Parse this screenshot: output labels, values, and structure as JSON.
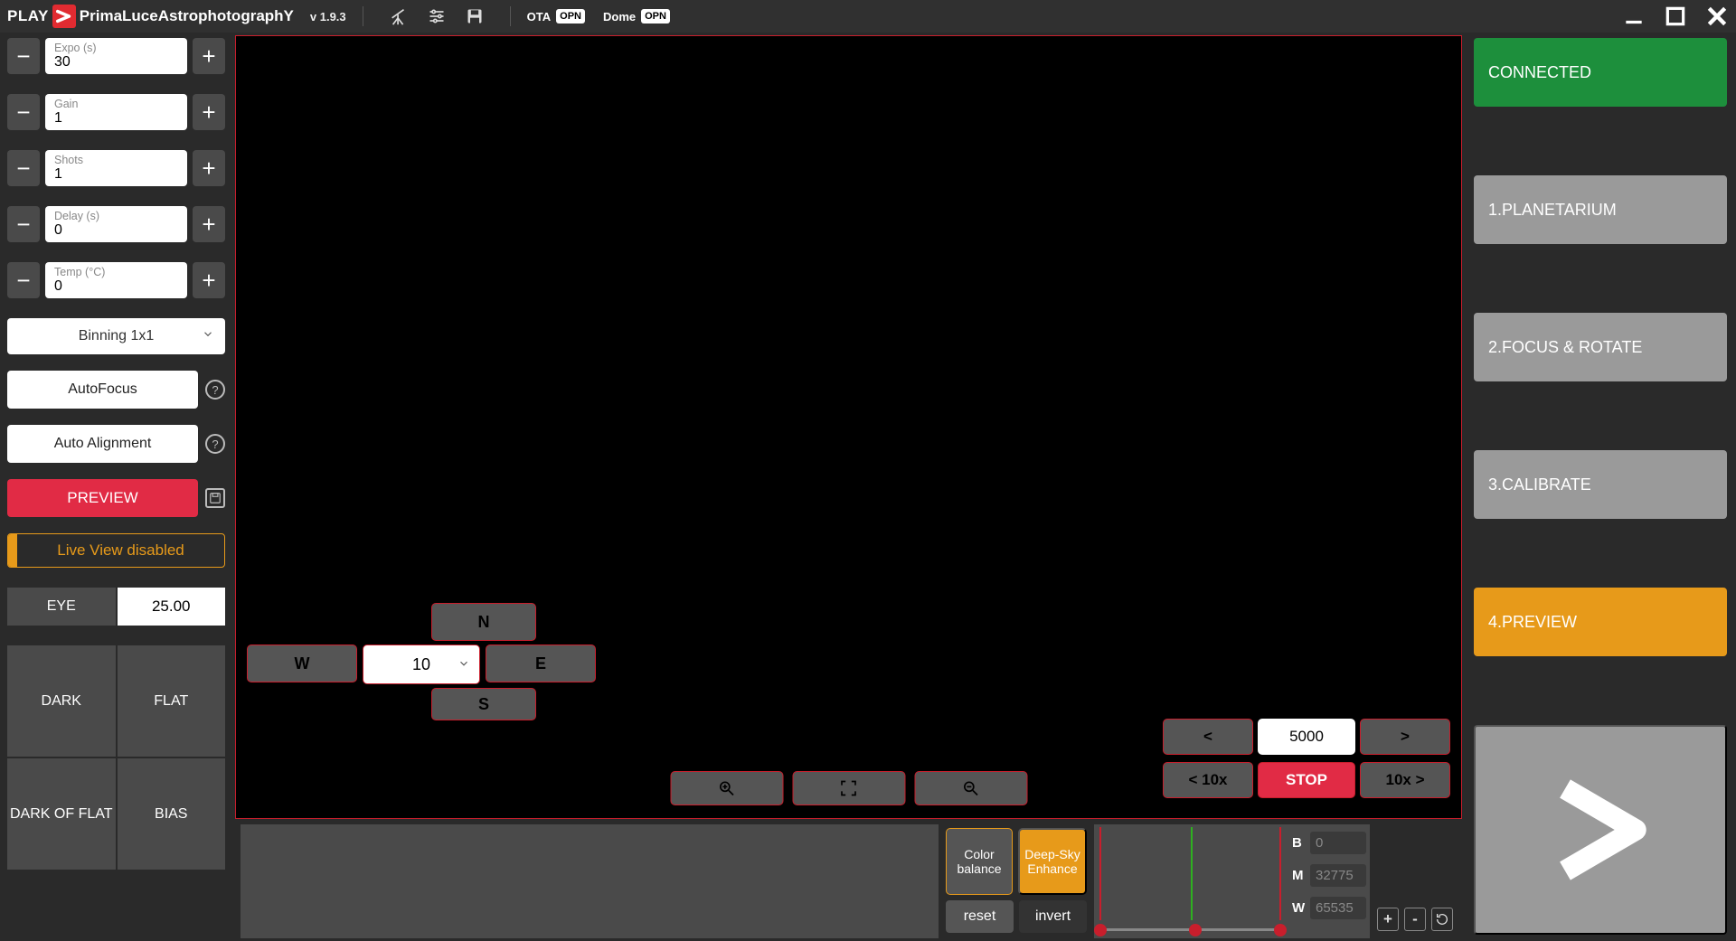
{
  "topbar": {
    "play": "PLAY",
    "brandP": "P",
    "brandRest1": "rimaLuce",
    "brandA": "A",
    "brandRest2": "strophotograph",
    "brandY": "Y",
    "version": "v 1.9.3",
    "ota": "OTA",
    "ota_status": "OPN",
    "dome": "Dome",
    "dome_status": "OPN"
  },
  "left": {
    "expo": {
      "label": "Expo (s)",
      "value": "30"
    },
    "gain": {
      "label": "Gain",
      "value": "1"
    },
    "shots": {
      "label": "Shots",
      "value": "1"
    },
    "delay": {
      "label": "Delay (s)",
      "value": "0"
    },
    "temp": {
      "label": "Temp (°C)",
      "value": "0"
    },
    "binning": "Binning 1x1",
    "autofocus": "AutoFocus",
    "autoalign": "Auto Alignment",
    "preview": "PREVIEW",
    "liveview": "Live View disabled",
    "eye": "EYE",
    "eye_val": "25.00",
    "dark": "DARK",
    "flat": "FLAT",
    "dark_of_flat": "DARK OF FLAT",
    "bias": "BIAS"
  },
  "main": {
    "dir": {
      "n": "N",
      "s": "S",
      "w": "W",
      "e": "E",
      "speed": "10"
    },
    "nav": {
      "left": "<",
      "right": ">",
      "val": "5000",
      "left10": "< 10x",
      "right10": "10x >",
      "stop": "STOP"
    }
  },
  "strip": {
    "color_balance": "Color balance",
    "deepsky": "Deep-Sky Enhance",
    "reset": "reset",
    "invert": "invert",
    "b": {
      "k": "B",
      "v": "0"
    },
    "m": {
      "k": "M",
      "v": "32775"
    },
    "w": {
      "k": "W",
      "v": "65535"
    },
    "plus": "+",
    "minus": "-"
  },
  "right": {
    "connected": "CONNECTED",
    "planetarium": "1.PLANETARIUM",
    "focus": "2.FOCUS & ROTATE",
    "calibrate": "3.CALIBRATE",
    "preview": "4.PREVIEW"
  }
}
